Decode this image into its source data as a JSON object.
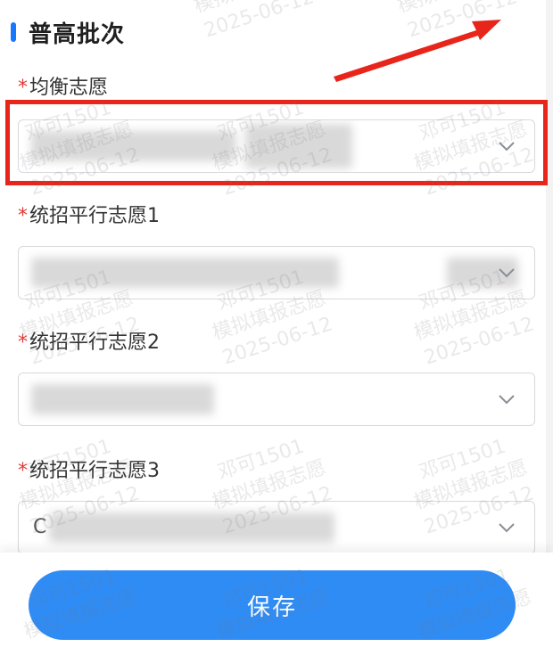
{
  "colors": {
    "accent": "#1677ff",
    "required": "#e53935",
    "annotation": "#e8251b",
    "button": "#2f8cf5"
  },
  "section": {
    "title": "普高批次"
  },
  "fields": [
    {
      "required_mark": "*",
      "label": "均衡志愿",
      "value_prefix": "",
      "chevron_icon": "chevron-down-icon"
    },
    {
      "required_mark": "*",
      "label": "统招平行志愿1",
      "value_prefix": "",
      "chevron_icon": "chevron-down-icon"
    },
    {
      "required_mark": "*",
      "label": "统招平行志愿2",
      "value_prefix": "",
      "chevron_icon": "chevron-down-icon"
    },
    {
      "required_mark": "*",
      "label": "统招平行志愿3",
      "value_prefix": "C",
      "chevron_icon": "chevron-down-icon"
    }
  ],
  "save_button": {
    "label": "保存"
  },
  "watermark": {
    "line1": "邓可1501",
    "line2": "模拟填报志愿",
    "line3": "2025-06-12"
  }
}
